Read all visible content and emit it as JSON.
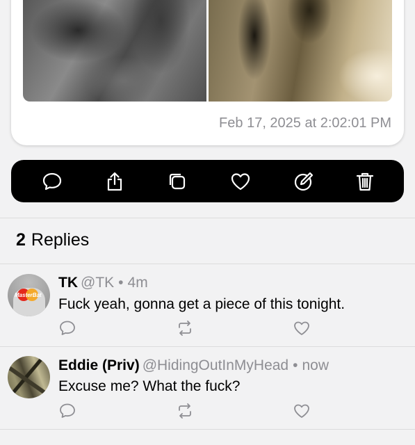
{
  "post": {
    "timestamp": "Feb 17, 2025 at 2:02:01 PM"
  },
  "toolbar": {
    "icons": [
      "comment-icon",
      "share-icon",
      "copy-icon",
      "heart-icon",
      "edit-icon",
      "trash-icon"
    ]
  },
  "replies_section": {
    "count": "2",
    "label": "Replies"
  },
  "replies": [
    {
      "name": "TK",
      "handle": "@TK",
      "separator": "•",
      "time": "4m",
      "text": "Fuck yeah, gonna get a piece of this tonight.",
      "avatar_text": "MasterBat"
    },
    {
      "name": "Eddie (Priv)",
      "handle": "@HidingOutInMyHead",
      "separator": "•",
      "time": "now",
      "text": "Excuse me? What the fuck?"
    }
  ],
  "colors": {
    "background": "#f2f2f3",
    "toolbar": "#000000",
    "secondary_text": "#8e8e93"
  }
}
